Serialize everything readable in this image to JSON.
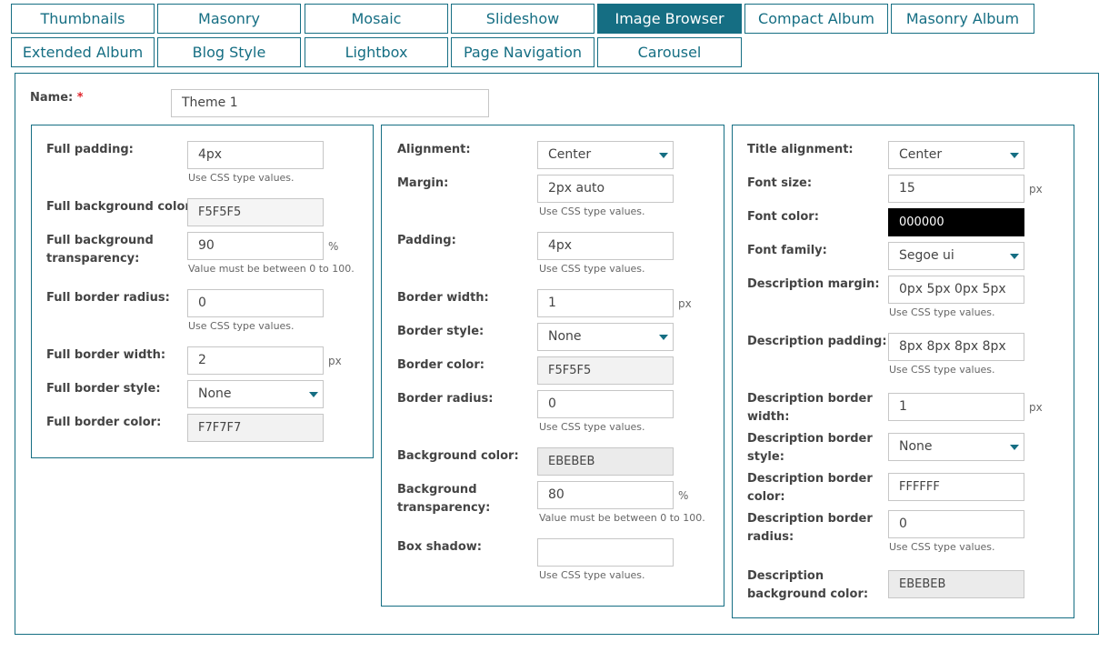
{
  "tabs": [
    {
      "label": "Thumbnails",
      "active": false
    },
    {
      "label": "Masonry",
      "active": false
    },
    {
      "label": "Mosaic",
      "active": false
    },
    {
      "label": "Slideshow",
      "active": false
    },
    {
      "label": "Image Browser",
      "active": true
    },
    {
      "label": "Compact Album",
      "active": false
    },
    {
      "label": "Masonry Album",
      "active": false
    },
    {
      "label": "Extended Album",
      "active": false
    },
    {
      "label": "Blog Style",
      "active": false
    },
    {
      "label": "Lightbox",
      "active": false
    },
    {
      "label": "Page Navigation",
      "active": false
    },
    {
      "label": "Carousel",
      "active": false
    }
  ],
  "colors": {
    "accent": "#156e83",
    "required": "#e0242b",
    "input_border": "#c6c6c6",
    "disabled_bg": "#f2f2f2"
  },
  "name": {
    "label": "Name:",
    "required_mark": "*",
    "value": "Theme 1"
  },
  "col1": {
    "full_padding": {
      "label": "Full padding:",
      "value": "4px",
      "hint": "Use CSS type values."
    },
    "full_bg_color": {
      "label": "Full background color:",
      "value": "F5F5F5"
    },
    "full_bg_transparency": {
      "label_1": "Full background",
      "label_2": "transparency:",
      "value": "90",
      "unit": "%",
      "hint": "Value must be between 0 to 100."
    },
    "full_border_radius": {
      "label": "Full border radius:",
      "value": "0",
      "hint": "Use CSS type values."
    },
    "full_border_width": {
      "label": "Full border width:",
      "value": "2",
      "unit": "px"
    },
    "full_border_style": {
      "label": "Full border style:",
      "value": "None",
      "icon": "chevron-down-icon"
    },
    "full_border_color": {
      "label": "Full border color:",
      "value": "F7F7F7"
    }
  },
  "col2": {
    "alignment": {
      "label": "Alignment:",
      "value": "Center",
      "icon": "chevron-down-icon"
    },
    "margin": {
      "label": "Margin:",
      "value": "2px auto",
      "hint": "Use CSS type values."
    },
    "padding": {
      "label": "Padding:",
      "value": "4px",
      "hint": "Use CSS type values."
    },
    "border_width": {
      "label": "Border width:",
      "value": "1",
      "unit": "px"
    },
    "border_style": {
      "label": "Border style:",
      "value": "None",
      "icon": "chevron-down-icon"
    },
    "border_color": {
      "label": "Border color:",
      "value": "F5F5F5"
    },
    "border_radius": {
      "label": "Border radius:",
      "value": "0",
      "hint": "Use CSS type values."
    },
    "bg_color": {
      "label": "Background color:",
      "value": "EBEBEB"
    },
    "bg_transparency": {
      "label_1": "Background",
      "label_2": "transparency:",
      "value": "80",
      "unit": "%",
      "hint": "Value must be between 0 to 100."
    },
    "box_shadow": {
      "label": "Box shadow:",
      "value": "",
      "hint": "Use CSS type values."
    }
  },
  "col3": {
    "title_alignment": {
      "label": "Title alignment:",
      "value": "Center",
      "icon": "chevron-down-icon"
    },
    "font_size": {
      "label": "Font size:",
      "value": "15",
      "unit": "px"
    },
    "font_color": {
      "label": "Font color:",
      "value": "000000"
    },
    "font_family": {
      "label": "Font family:",
      "value": "Segoe ui",
      "icon": "chevron-down-icon"
    },
    "desc_margin": {
      "label": "Description margin:",
      "value": "0px 5px 0px 5px",
      "hint": "Use CSS type values."
    },
    "desc_padding": {
      "label": "Description padding:",
      "value": "8px 8px 8px 8px",
      "hint": "Use CSS type values."
    },
    "desc_border_width": {
      "label_1": "Description border",
      "label_2": "width:",
      "value": "1",
      "unit": "px"
    },
    "desc_border_style": {
      "label_1": "Description border",
      "label_2": "style:",
      "value": "None",
      "icon": "chevron-down-icon"
    },
    "desc_border_color": {
      "label_1": "Description border",
      "label_2": "color:",
      "value": "FFFFFF"
    },
    "desc_border_radius": {
      "label_1": "Description border",
      "label_2": "radius:",
      "value": "0",
      "hint": "Use CSS type values."
    },
    "desc_bg_color": {
      "label_1": "Description",
      "label_2": "background color:",
      "value": "EBEBEB"
    }
  }
}
